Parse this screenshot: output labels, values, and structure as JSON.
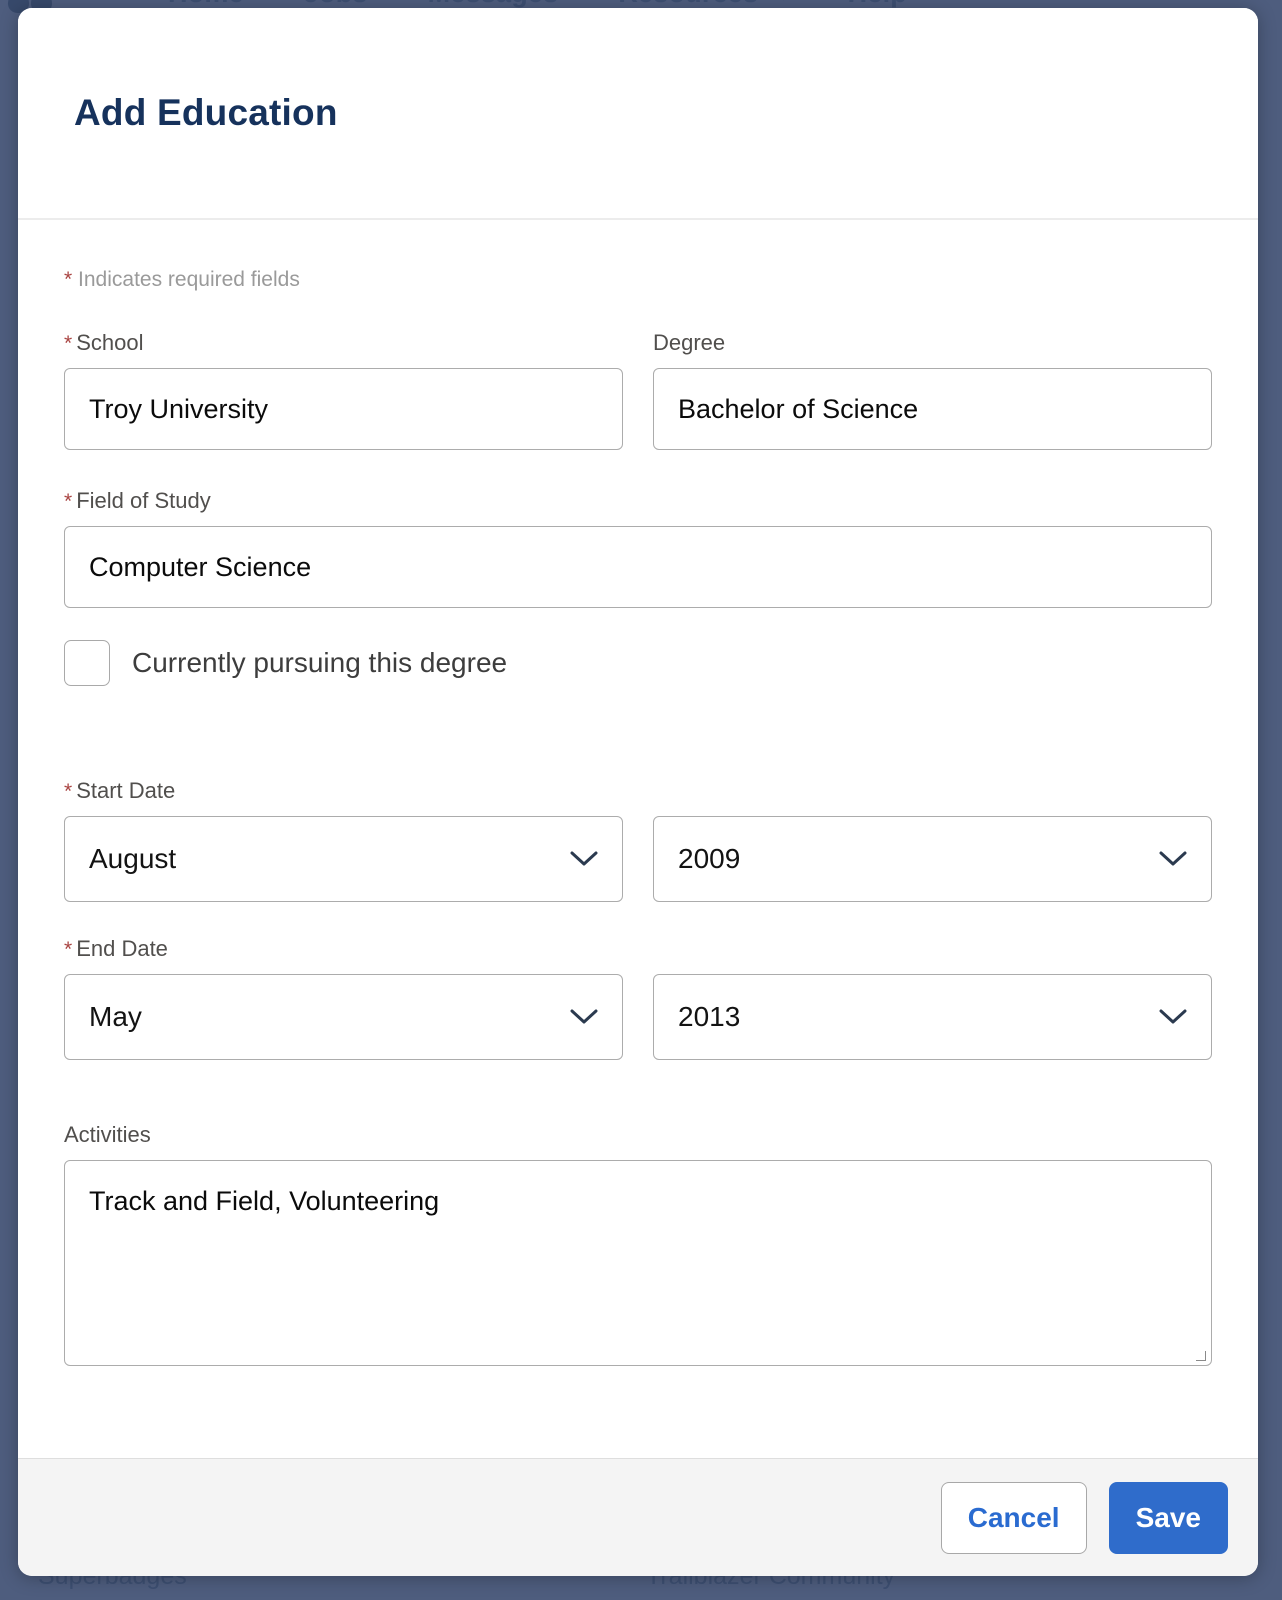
{
  "background": {
    "nav": {
      "logo_icon": "trailhead-logo-icon",
      "items": [
        {
          "label": "Home",
          "has_caret": false
        },
        {
          "label": "Jobs",
          "has_caret": false
        },
        {
          "label": "Messages",
          "has_caret": false
        },
        {
          "label": "Resources",
          "has_caret": true
        },
        {
          "label": "Help",
          "has_caret": false
        }
      ],
      "caret_glyph": "▾"
    },
    "footer": {
      "column_a": "Superbadges",
      "column_b": "Trailblazer Community"
    },
    "overlay_color": "#4e5d7e"
  },
  "modal": {
    "title": "Add Education",
    "required_note": {
      "star": "*",
      "text": "Indicates required fields"
    },
    "fields": {
      "school": {
        "label": "School",
        "required": true,
        "star": "*",
        "value": "Troy University",
        "placeholder": ""
      },
      "degree": {
        "label": "Degree",
        "required": false,
        "value": "Bachelor of Science",
        "placeholder": ""
      },
      "field_of_study": {
        "label": "Field of Study",
        "required": true,
        "star": "*",
        "value": "Computer Science",
        "placeholder": ""
      },
      "currently_pursuing": {
        "label": "Currently pursuing this degree",
        "checked": false
      },
      "start_date": {
        "label": "Start Date",
        "required": true,
        "star": "*",
        "month": "August",
        "year": "2009"
      },
      "end_date": {
        "label": "End Date",
        "required": true,
        "star": "*",
        "month": "May",
        "year": "2013"
      },
      "activities": {
        "label": "Activities",
        "required": false,
        "value": "Track and Field, Volunteering",
        "placeholder": ""
      }
    },
    "footer": {
      "cancel_label": "Cancel",
      "save_label": "Save"
    }
  },
  "colors": {
    "title": "#16325c",
    "required_star": "#a94442",
    "primary_button": "#2f6ccb",
    "link_blue": "#2a6bd0",
    "overlay": "#4e5d7e",
    "input_border": "#acacac"
  }
}
